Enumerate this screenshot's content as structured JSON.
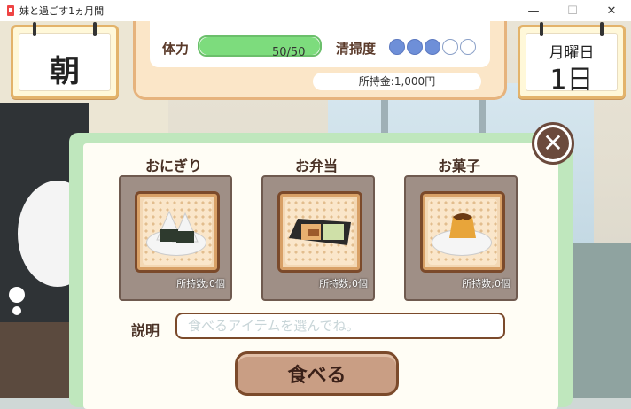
{
  "window": {
    "title": "妹と過ごす1ヵ月間",
    "minimize": "—",
    "maximize": "☐",
    "close": "✕"
  },
  "time": {
    "period": "朝"
  },
  "date": {
    "weekday": "月曜日",
    "day": "1日"
  },
  "status": {
    "hp_label": "体力",
    "hp_value": "50/50",
    "hp_fraction": 1.0,
    "clean_label": "清掃度",
    "clean_level": 3,
    "clean_max": 5,
    "money": "所持金:1,000円"
  },
  "dialog": {
    "close_label": "✕",
    "items": [
      {
        "name": "おにぎり",
        "count": "所持数;0個"
      },
      {
        "name": "お弁当",
        "count": "所持数;0個"
      },
      {
        "name": "お菓子",
        "count": "所持数;0個"
      }
    ],
    "desc_label": "説明",
    "desc_placeholder": "食べるアイテムを選んでね。",
    "eat_label": "食べる"
  },
  "colors": {
    "hp_fill": "#7ddc7d",
    "clean_on": "#6e8fd8",
    "dialog_border": "#bfe7bd",
    "accent_brown": "#7b4a2b"
  }
}
